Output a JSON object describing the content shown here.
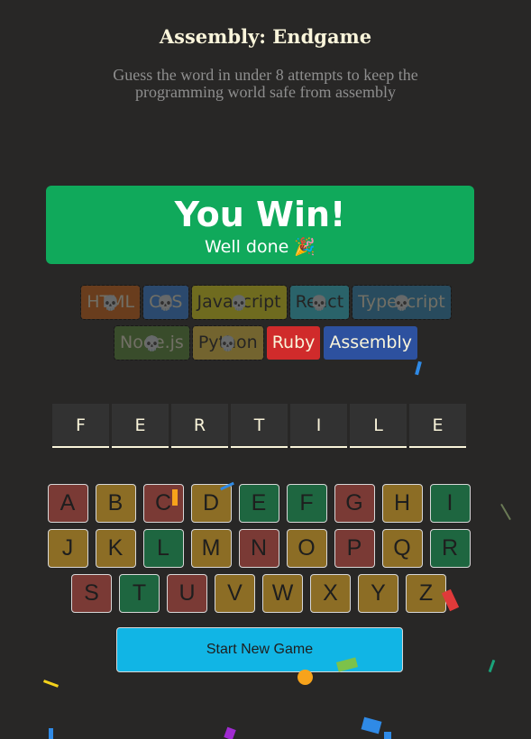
{
  "header": {
    "title": "Assembly: Endgame",
    "subtitle": "Guess the word in under 8 attempts to keep the programming world safe from assembly"
  },
  "status": {
    "title": "You Win!",
    "subtitle": "Well done 🎉"
  },
  "languages": [
    {
      "name": "HTML",
      "bg": "#e2680f",
      "color": "#f9f4da",
      "lost": true
    },
    {
      "name": "CSS",
      "bg": "#328af1",
      "color": "#f9f4da",
      "lost": true
    },
    {
      "name": "Javascript",
      "bg": "#f4eb13",
      "color": "#1e1e1e",
      "lost": true
    },
    {
      "name": "React",
      "bg": "#2ed3e9",
      "color": "#1e1e1e",
      "lost": true
    },
    {
      "name": "Typescript",
      "bg": "#298ec6",
      "color": "#f9f4da",
      "lost": true
    },
    {
      "name": "Node.js",
      "bg": "#599137",
      "color": "#f9f4da",
      "lost": true
    },
    {
      "name": "Python",
      "bg": "#ffd742",
      "color": "#1e1e1e",
      "lost": true
    },
    {
      "name": "Ruby",
      "bg": "#d02b2b",
      "color": "#f9f4da",
      "lost": false
    },
    {
      "name": "Assembly",
      "bg": "#2d519f",
      "color": "#f9f4da",
      "lost": false
    }
  ],
  "skull_glyph": "💀",
  "word": [
    "F",
    "E",
    "R",
    "T",
    "I",
    "L",
    "E"
  ],
  "keyboard": [
    {
      "k": "A",
      "s": "wrong"
    },
    {
      "k": "B",
      "s": "unused"
    },
    {
      "k": "C",
      "s": "wrong"
    },
    {
      "k": "D",
      "s": "unused"
    },
    {
      "k": "E",
      "s": "right"
    },
    {
      "k": "F",
      "s": "right"
    },
    {
      "k": "G",
      "s": "wrong"
    },
    {
      "k": "H",
      "s": "unused"
    },
    {
      "k": "I",
      "s": "right"
    },
    {
      "k": "J",
      "s": "unused"
    },
    {
      "k": "K",
      "s": "unused"
    },
    {
      "k": "L",
      "s": "right"
    },
    {
      "k": "M",
      "s": "unused"
    },
    {
      "k": "N",
      "s": "wrong"
    },
    {
      "k": "O",
      "s": "unused"
    },
    {
      "k": "P",
      "s": "wrong"
    },
    {
      "k": "Q",
      "s": "unused"
    },
    {
      "k": "R",
      "s": "right"
    },
    {
      "k": "S",
      "s": "wrong"
    },
    {
      "k": "T",
      "s": "right"
    },
    {
      "k": "U",
      "s": "wrong"
    },
    {
      "k": "V",
      "s": "unused"
    },
    {
      "k": "W",
      "s": "unused"
    },
    {
      "k": "X",
      "s": "unused"
    },
    {
      "k": "Y",
      "s": "unused"
    },
    {
      "k": "Z",
      "s": "unused"
    }
  ],
  "actions": {
    "new_game_label": "Start New Game"
  }
}
